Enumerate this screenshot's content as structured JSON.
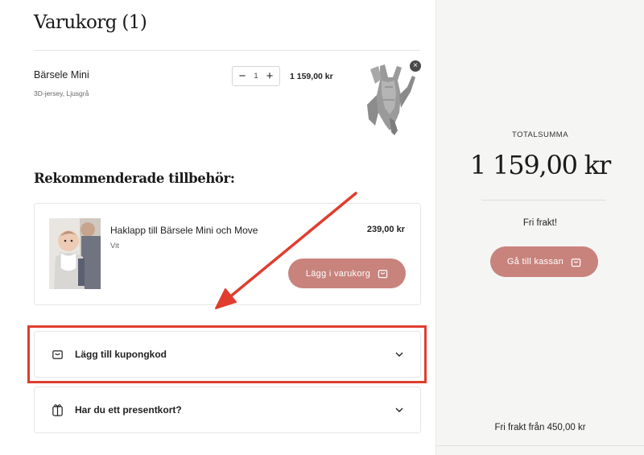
{
  "cart": {
    "title": "Varukorg (1)",
    "item": {
      "name": "Bärsele Mini",
      "variant": "3D-jersey, Ljusgrå",
      "quantity": "1",
      "qty_minus": "−",
      "qty_plus": "+",
      "price": "1 159,00 kr",
      "remove_glyph": "×"
    }
  },
  "recommendations": {
    "title": "Rekommenderade tillbehör:",
    "items": [
      {
        "name": "Haklapp till Bärsele Mini och Move",
        "variant": "Vit",
        "price": "239,00 kr",
        "button_label": "Lägg i varukorg"
      }
    ]
  },
  "accordions": {
    "coupon_label": "Lägg till kupongkod",
    "gift_label": "Har du ett presentkort?"
  },
  "summary": {
    "total_label": "TOTALSUMMA",
    "total_amount": "1 159,00 kr",
    "free_shipping": "Fri frakt!",
    "checkout_label": "Gå till kassan",
    "free_shipping_from": "Fri frakt från 450,00 kr"
  },
  "colors": {
    "accent": "#c8837c",
    "annotation": "#e03d2e",
    "sidebar_bg": "#f5f5f4"
  },
  "icons": {
    "remove": "close-icon",
    "cart_button": "shopping-bag-icon",
    "coupon": "shopping-bag-icon",
    "gift_card": "gift-icon",
    "expand": "chevron-down-icon"
  }
}
